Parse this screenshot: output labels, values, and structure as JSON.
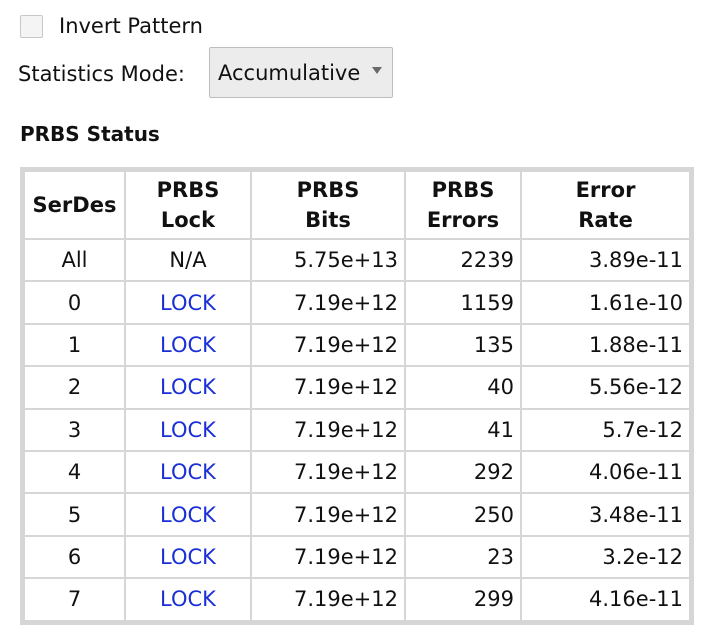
{
  "invert_pattern": {
    "label": "Invert Pattern",
    "checked": false
  },
  "statistics_mode": {
    "label": "Statistics Mode:",
    "selected": "Accumulative"
  },
  "prbs_status": {
    "title": "PRBS Status",
    "columns": [
      {
        "line1": "SerDes",
        "line2": ""
      },
      {
        "line1": "PRBS",
        "line2": "Lock"
      },
      {
        "line1": "PRBS",
        "line2": "Bits"
      },
      {
        "line1": "PRBS",
        "line2": "Errors"
      },
      {
        "line1": "Error",
        "line2": "Rate"
      }
    ],
    "rows": [
      {
        "serdes": "All",
        "lock": "N/A",
        "bits": "5.75e+13",
        "errors": "2239",
        "rate": "3.89e-11"
      },
      {
        "serdes": "0",
        "lock": "LOCK",
        "bits": "7.19e+12",
        "errors": "1159",
        "rate": "1.61e-10"
      },
      {
        "serdes": "1",
        "lock": "LOCK",
        "bits": "7.19e+12",
        "errors": "135",
        "rate": "1.88e-11"
      },
      {
        "serdes": "2",
        "lock": "LOCK",
        "bits": "7.19e+12",
        "errors": "40",
        "rate": "5.56e-12"
      },
      {
        "serdes": "3",
        "lock": "LOCK",
        "bits": "7.19e+12",
        "errors": "41",
        "rate": "5.7e-12"
      },
      {
        "serdes": "4",
        "lock": "LOCK",
        "bits": "7.19e+12",
        "errors": "292",
        "rate": "4.06e-11"
      },
      {
        "serdes": "5",
        "lock": "LOCK",
        "bits": "7.19e+12",
        "errors": "250",
        "rate": "3.48e-11"
      },
      {
        "serdes": "6",
        "lock": "LOCK",
        "bits": "7.19e+12",
        "errors": "23",
        "rate": "3.2e-12"
      },
      {
        "serdes": "7",
        "lock": "LOCK",
        "bits": "7.19e+12",
        "errors": "299",
        "rate": "4.16e-11"
      }
    ]
  },
  "colors": {
    "lock_text": "#1a2fd6",
    "grid": "#d6d6d6"
  }
}
